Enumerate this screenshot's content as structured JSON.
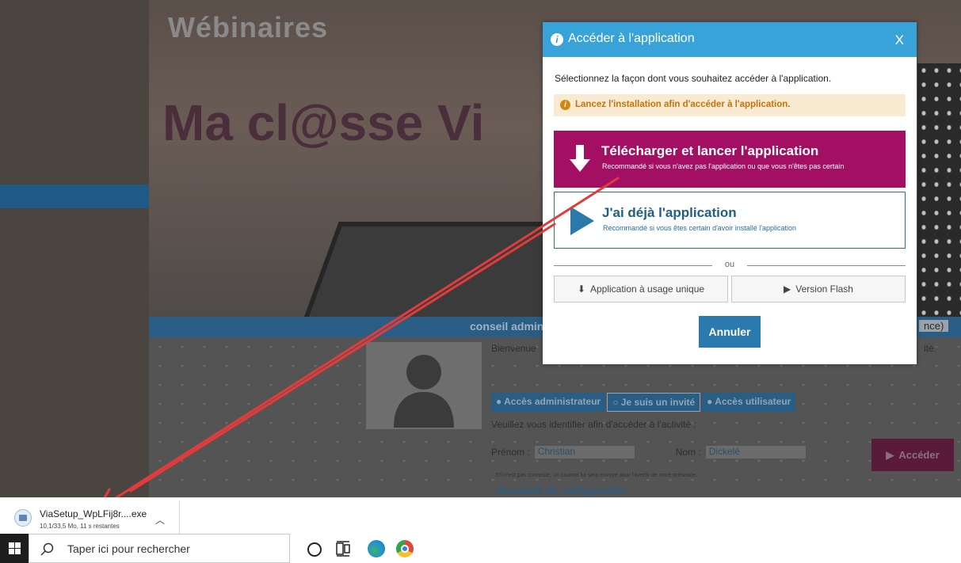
{
  "background_page": {
    "brand_text": "Wébinaires",
    "hero_title": "Ma cl@sse Vi",
    "band_text": "conseil admin",
    "band_right_text": "nce)",
    "welcome_text": "Bienvenue",
    "right_note": "ité.",
    "tabs": [
      {
        "label": "● Accès administrateur"
      },
      {
        "label": "○ Je suis un invité"
      },
      {
        "label": "● Accès utilisateur"
      }
    ],
    "identify_text": "Veuillez vous identifier afin d'accéder à l'activité :",
    "first_name_label": "Prénom :",
    "first_name_value": "Christian",
    "last_name_label": "Nom :",
    "last_name_value": "Dickelé",
    "access_button": "Accéder",
    "small_note": "S'il n'est pas connecté, un courriel lui sera envoyé pour l'avertir de votre présence.",
    "assistant_text": "Assistant de configuration"
  },
  "modal": {
    "title": "Accéder à l'application",
    "close_label": "X",
    "intro": "Sélectionnez la façon dont vous souhaitez accéder à l'application.",
    "alert": "Lancez l'installation afin d'accéder à l'application.",
    "download": {
      "title": "Télécharger et lancer l'application",
      "subtitle": "Recommandé si vous n'avez pas l'application ou que vous n'êtes pas certain"
    },
    "already": {
      "title": "J'ai déjà l'application",
      "subtitle": "Recommandé si vous êtes certain d'avoir installé l'application"
    },
    "separator": "ou",
    "single_use_label": "Application à usage unique",
    "flash_label": "Version Flash",
    "cancel_label": "Annuler"
  },
  "download_bar": {
    "file_name": "ViaSetup_WpLFij8r....exe",
    "status": "10,1/33,5 Mo, 11 s restantes"
  },
  "taskbar": {
    "search_placeholder": "Taper ici pour rechercher"
  },
  "colors": {
    "modal_header": "#37a3d9",
    "download_button": "#a20f63",
    "alert_bg": "#f9ead2",
    "alert_text": "#c7730b",
    "cancel_button": "#2a7ab0",
    "annotation_arrow": "#e23b3b"
  }
}
